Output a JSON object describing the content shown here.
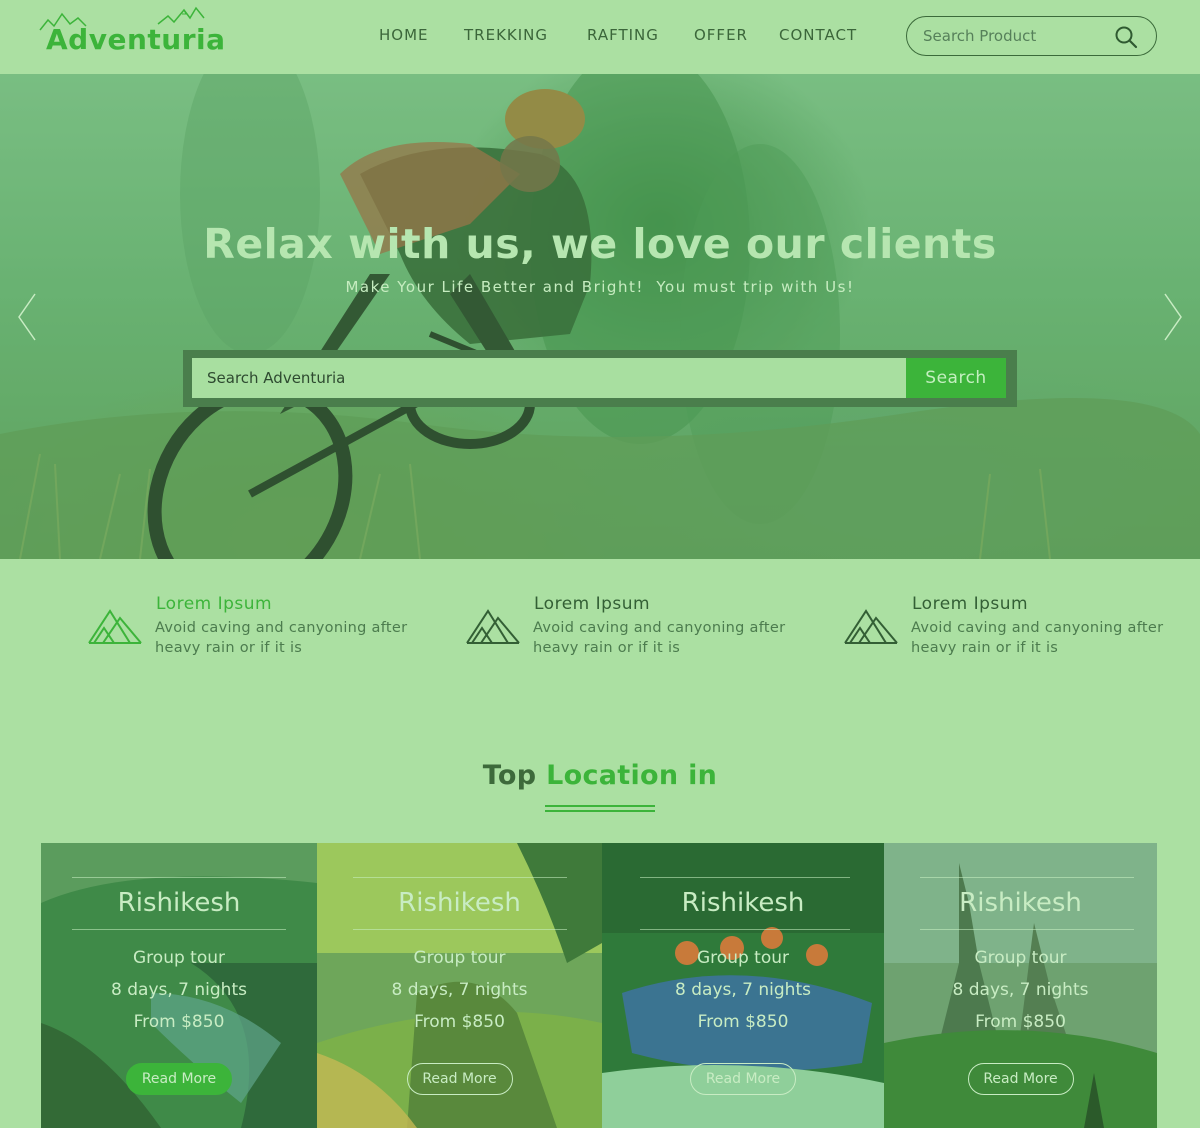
{
  "brand": {
    "name": "Adventuria"
  },
  "nav": {
    "items": [
      {
        "label": "HOME"
      },
      {
        "label": "TREKKING"
      },
      {
        "label": "RAFTING"
      },
      {
        "label": "OFFER"
      },
      {
        "label": "CONTACT"
      }
    ]
  },
  "header_search": {
    "placeholder": "Search Product",
    "icon": "search-icon"
  },
  "hero": {
    "title": "Relax with us, we love our clients",
    "subtitle": "Make Your Life Better and Bright!  You must trip with Us!",
    "search_placeholder": "Search Adventuria",
    "search_button": "Search",
    "prev_icon": "chevron-left-icon",
    "next_icon": "chevron-right-icon"
  },
  "features": [
    {
      "title": "Lorem Ipsum",
      "text": "Avoid caving and canyoning after heavy rain or if it is",
      "icon": "mountain-icon",
      "accent": "#3cb43a"
    },
    {
      "title": "Lorem Ipsum",
      "text": "Avoid caving and canyoning after heavy rain or if it is",
      "icon": "mountain-icon",
      "accent": "#335f35"
    },
    {
      "title": "Lorem Ipsum",
      "text": "Avoid caving and canyoning after heavy rain or if it is",
      "icon": "mountain-icon",
      "accent": "#335f35"
    }
  ],
  "section": {
    "title_part1": "Top ",
    "title_part2": "Location in"
  },
  "locations": [
    {
      "name": "Rishikesh",
      "tour": "Group tour",
      "duration": "8 days, 7 nights",
      "price": "From $850",
      "button": "Read More"
    },
    {
      "name": "Rishikesh",
      "tour": "Group tour",
      "duration": "8 days, 7 nights",
      "price": "From $850",
      "button": "Read More"
    },
    {
      "name": "Rishikesh",
      "tour": "Group tour",
      "duration": "8 days, 7 nights",
      "price": "From $850",
      "button": "Read More"
    },
    {
      "name": "Rishikesh",
      "tour": "Group tour",
      "duration": "8 days, 7 nights",
      "price": "From $850",
      "button": "Read More"
    }
  ],
  "colors": {
    "accent": "#3cb43a",
    "background": "#abe0a2",
    "text": "#3e6a3c"
  }
}
